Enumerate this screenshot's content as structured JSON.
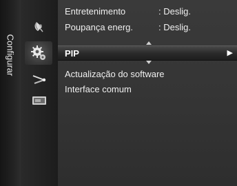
{
  "sidebar": {
    "label": "Configurar"
  },
  "categories": [
    {
      "icon": "satellite-dish-icon"
    },
    {
      "icon": "gear-icon",
      "selected": true
    },
    {
      "icon": "antenna-icon"
    },
    {
      "icon": "tv-input-icon"
    }
  ],
  "menu": {
    "items": [
      {
        "label": "Entretenimento",
        "value": ": Deslig."
      },
      {
        "label": "Poupança energ.",
        "value": ": Deslig."
      },
      {
        "label": "PIP",
        "selected": true
      },
      {
        "label": "Actualização do software"
      },
      {
        "label": "Interface comum"
      }
    ],
    "arrow": "▶"
  },
  "colors": {
    "text": "#f0f0f0",
    "background": "#353535",
    "selection": "#1e1e1e"
  }
}
